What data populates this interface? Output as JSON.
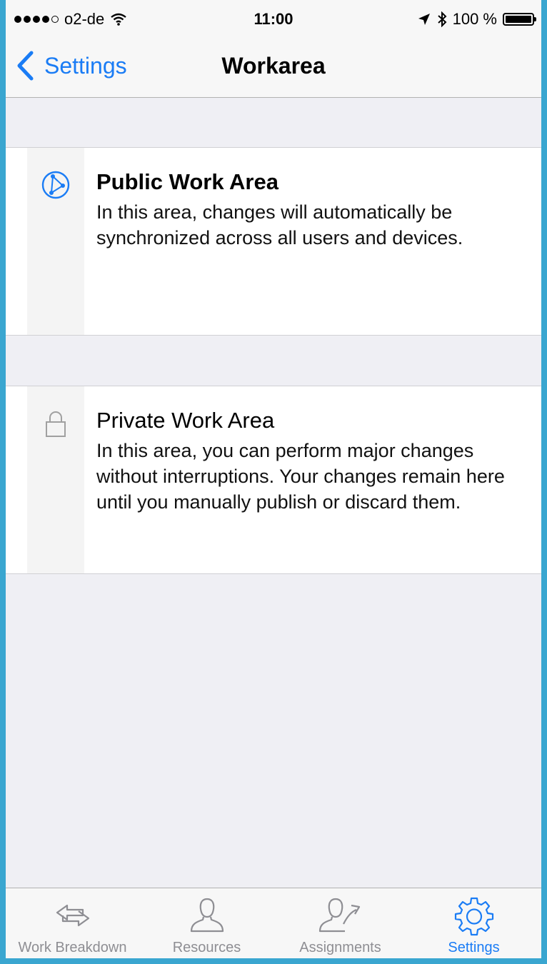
{
  "status_bar": {
    "carrier": "o2-de",
    "time": "11:00",
    "battery": "100 %"
  },
  "nav": {
    "back_label": "Settings",
    "title": "Workarea"
  },
  "areas": [
    {
      "icon": "network-globe-icon",
      "title": "Public Work Area",
      "description": "In this area, changes will automatically be synchronized across all users and devices.",
      "selected": true
    },
    {
      "icon": "lock-icon",
      "title": "Private Work Area",
      "description": "In this area, you can perform major changes without interruptions. Your changes remain here until you manually publish or discard them.",
      "selected": false
    }
  ],
  "tabs": [
    {
      "label": "Work Breakdown",
      "icon": "arrows-exchange-icon",
      "active": false
    },
    {
      "label": "Resources",
      "icon": "person-icon",
      "active": false
    },
    {
      "label": "Assignments",
      "icon": "person-arrow-icon",
      "active": false
    },
    {
      "label": "Settings",
      "icon": "gear-icon",
      "active": true
    }
  ],
  "colors": {
    "accent": "#1a7cf5",
    "inactive": "#8e8e93",
    "background": "#efeff4"
  }
}
